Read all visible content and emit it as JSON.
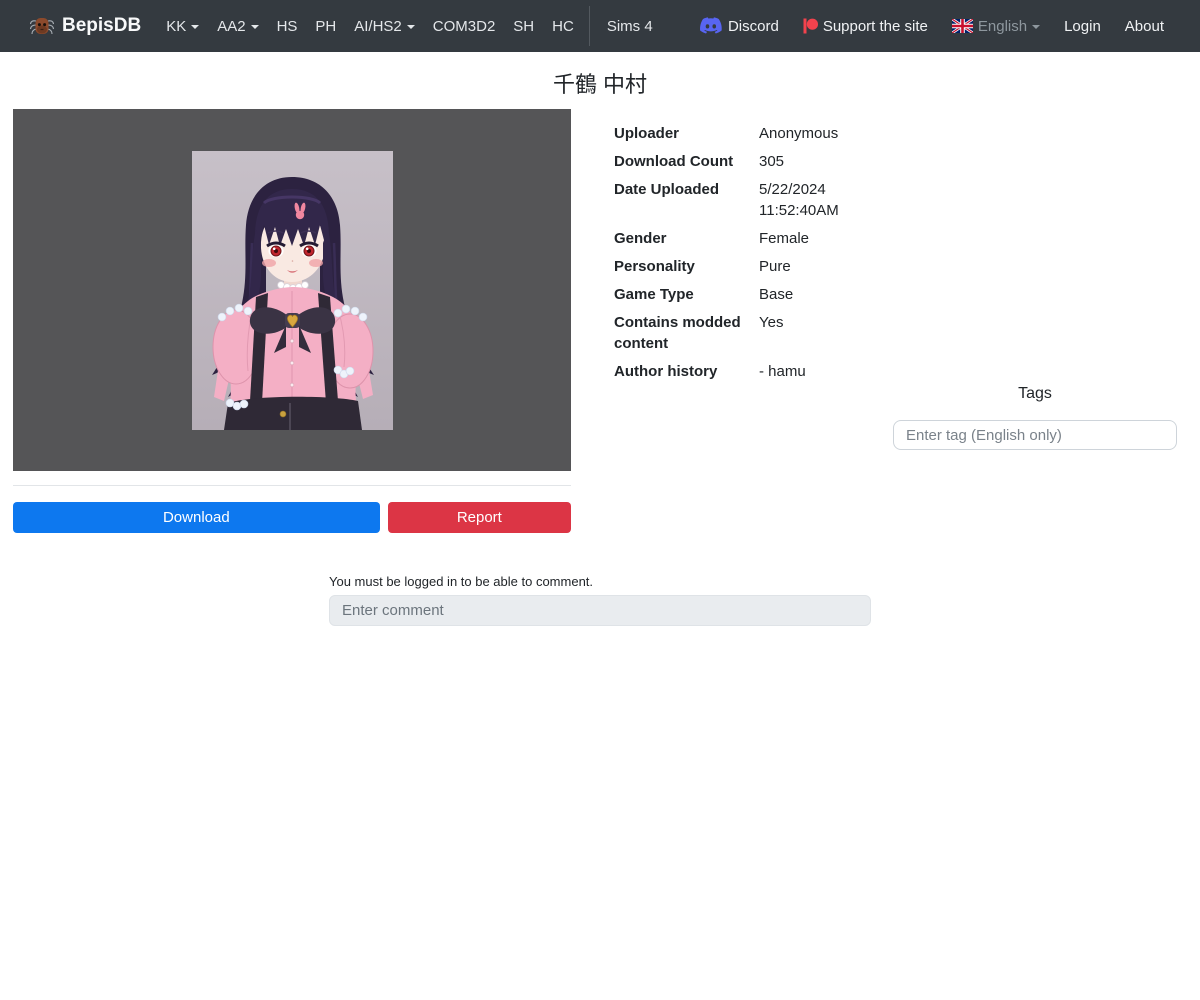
{
  "navbar": {
    "brand": "BepisDB",
    "items": [
      {
        "label": "KK",
        "has_menu": true
      },
      {
        "label": "AA2",
        "has_menu": true
      },
      {
        "label": "HS",
        "has_menu": false
      },
      {
        "label": "PH",
        "has_menu": false
      },
      {
        "label": "AI/HS2",
        "has_menu": true
      },
      {
        "label": "COM3D2",
        "has_menu": false
      },
      {
        "label": "SH",
        "has_menu": false
      },
      {
        "label": "HC",
        "has_menu": false
      }
    ],
    "sims_label": "Sims 4",
    "discord_label": "Discord",
    "support_label": "Support the site",
    "language_label": "English",
    "login_label": "Login",
    "about_label": "About"
  },
  "page": {
    "title": "千鶴 中村"
  },
  "details": {
    "rows": [
      {
        "label": "Uploader",
        "value": "Anonymous"
      },
      {
        "label": "Download Count",
        "value": "305"
      },
      {
        "label": "Date Uploaded",
        "value": "5/22/2024 11:52:40AM"
      },
      {
        "label": "Gender",
        "value": "Female"
      },
      {
        "label": "Personality",
        "value": "Pure"
      },
      {
        "label": "Game Type",
        "value": "Base"
      },
      {
        "label": "Contains modded content",
        "value": "Yes"
      },
      {
        "label": "Author history",
        "value": "- hamu"
      }
    ]
  },
  "tags": {
    "title": "Tags",
    "placeholder": "Enter tag (English only)"
  },
  "actions": {
    "download_label": "Download",
    "report_label": "Report"
  },
  "comments": {
    "login_note": "You must be logged in to be able to comment.",
    "placeholder": "Enter comment"
  },
  "colors": {
    "navbar_bg": "#343a40",
    "accent_blue": "#0d78ef",
    "danger_red": "#dc3545",
    "discord_blurple": "#5865f2",
    "patreon_coral": "#ff424d",
    "panel_gray": "#555557"
  }
}
